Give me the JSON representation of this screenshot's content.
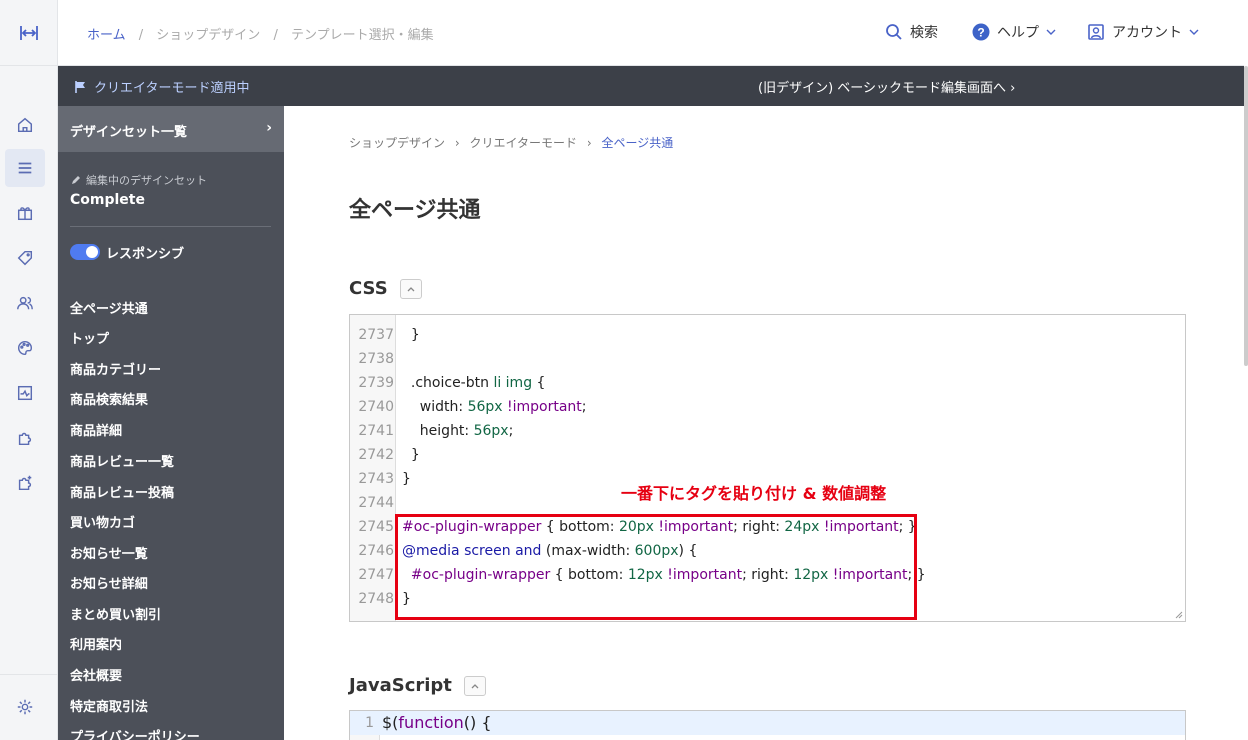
{
  "topbar": {
    "breadcrumb": [
      "ホーム",
      "ショップデザイン",
      "テンプレート選択・編集"
    ],
    "search_label": "検索",
    "help_label": "ヘルプ",
    "account_label": "アカウント"
  },
  "creator_bar": {
    "status": "クリエイターモード適用中",
    "old_design_link": "(旧デザイン) ベーシックモード編集画面へ ›"
  },
  "sidebar": {
    "design_set_list": "デザインセット一覧",
    "design_set_chevron": "›",
    "editing_label": "編集中のデザインセット",
    "editing_name": "Complete",
    "responsive_label": "レスポンシブ",
    "pages": [
      "全ページ共通",
      "トップ",
      "商品カテゴリー",
      "商品検索結果",
      "商品詳細",
      "商品レビュー一覧",
      "商品レビュー投稿",
      "買い物カゴ",
      "お知らせ一覧",
      "お知らせ詳細",
      "まとめ買い割引",
      "利用案内",
      "会社概要",
      "特定商取引法",
      "プライバシーポリシー"
    ]
  },
  "main": {
    "breadcrumb": [
      "ショップデザイン",
      "クリエイターモード",
      "全ページ共通"
    ],
    "breadcrumb_sep": "›",
    "title": "全ページ共通",
    "css_section": "CSS",
    "js_section": "JavaScript",
    "annotation": "一番下にタグを貼り付け & 数値調整",
    "css_lines": [
      {
        "n": "2737",
        "code": "  }"
      },
      {
        "n": "2738",
        "code": ""
      },
      {
        "n": "2739",
        "code": "  .choice-btn li img {"
      },
      {
        "n": "2740",
        "code": "    width: 56px !important;"
      },
      {
        "n": "2741",
        "code": "    height: 56px;"
      },
      {
        "n": "2742",
        "code": "  }"
      },
      {
        "n": "2743",
        "code": "}"
      },
      {
        "n": "2744",
        "code": ""
      },
      {
        "n": "2745",
        "code": "#oc-plugin-wrapper { bottom: 20px !important; right: 24px !important; }"
      },
      {
        "n": "2746",
        "code": "@media screen and (max-width: 600px) {"
      },
      {
        "n": "2747",
        "code": "  #oc-plugin-wrapper { bottom: 12px !important; right: 12px !important; }"
      },
      {
        "n": "2748",
        "code": "}"
      }
    ],
    "js_lines": [
      {
        "n": "1",
        "code": "$(function() {"
      }
    ]
  },
  "colors": {
    "accent": "#4a63c8",
    "annotation": "#e60012",
    "sidebar_bg": "#4c5059",
    "creator_bar_bg": "#3c4048"
  },
  "icons": [
    "resize-icon",
    "home-icon",
    "menu-icon",
    "gift-icon",
    "tag-icon",
    "users-icon",
    "palette-icon",
    "chart-icon",
    "puzzle-icon",
    "puzzle-plus-icon",
    "settings-icon",
    "search-icon",
    "help-icon",
    "account-icon",
    "flag-icon",
    "pencil-icon"
  ]
}
